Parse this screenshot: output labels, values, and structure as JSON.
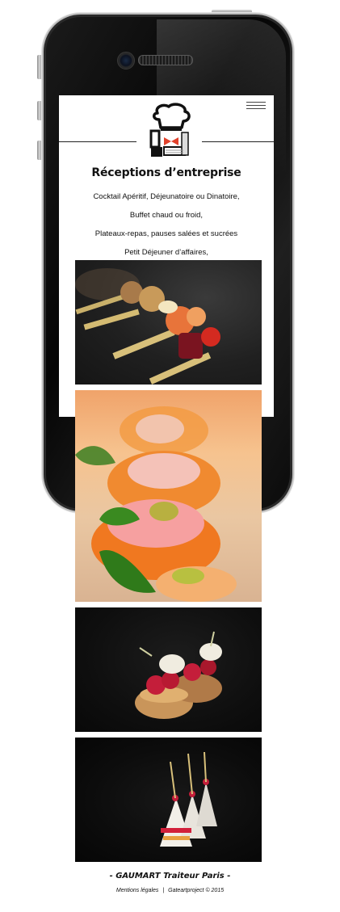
{
  "header": {
    "menu_icon": "hamburger-menu-icon",
    "logo_icon": "chef-hat-logo-icon"
  },
  "main": {
    "title": "Réceptions d’entreprise",
    "services": [
      "Cocktail Apéritif, Déjeunatoire ou Dinatoire,",
      "Buffet chaud ou froid,",
      "Plateaux-repas, pauses salées et sucrées",
      "Petit Déjeuner d’affaires,"
    ],
    "photos": [
      "canape-skewers-photo",
      "melon-prosciutto-photo",
      "raspberry-pastry-photo",
      "layered-dessert-photo"
    ]
  },
  "footer": {
    "title": "- GAUMART Traiteur Paris -",
    "legal_link": "Mentions légales",
    "separator": "|",
    "credit": "Gateartproject © 2015"
  },
  "colors": {
    "logo_accent": "#e0412b",
    "phone_body": "#0b0b0b",
    "text": "#111111"
  }
}
